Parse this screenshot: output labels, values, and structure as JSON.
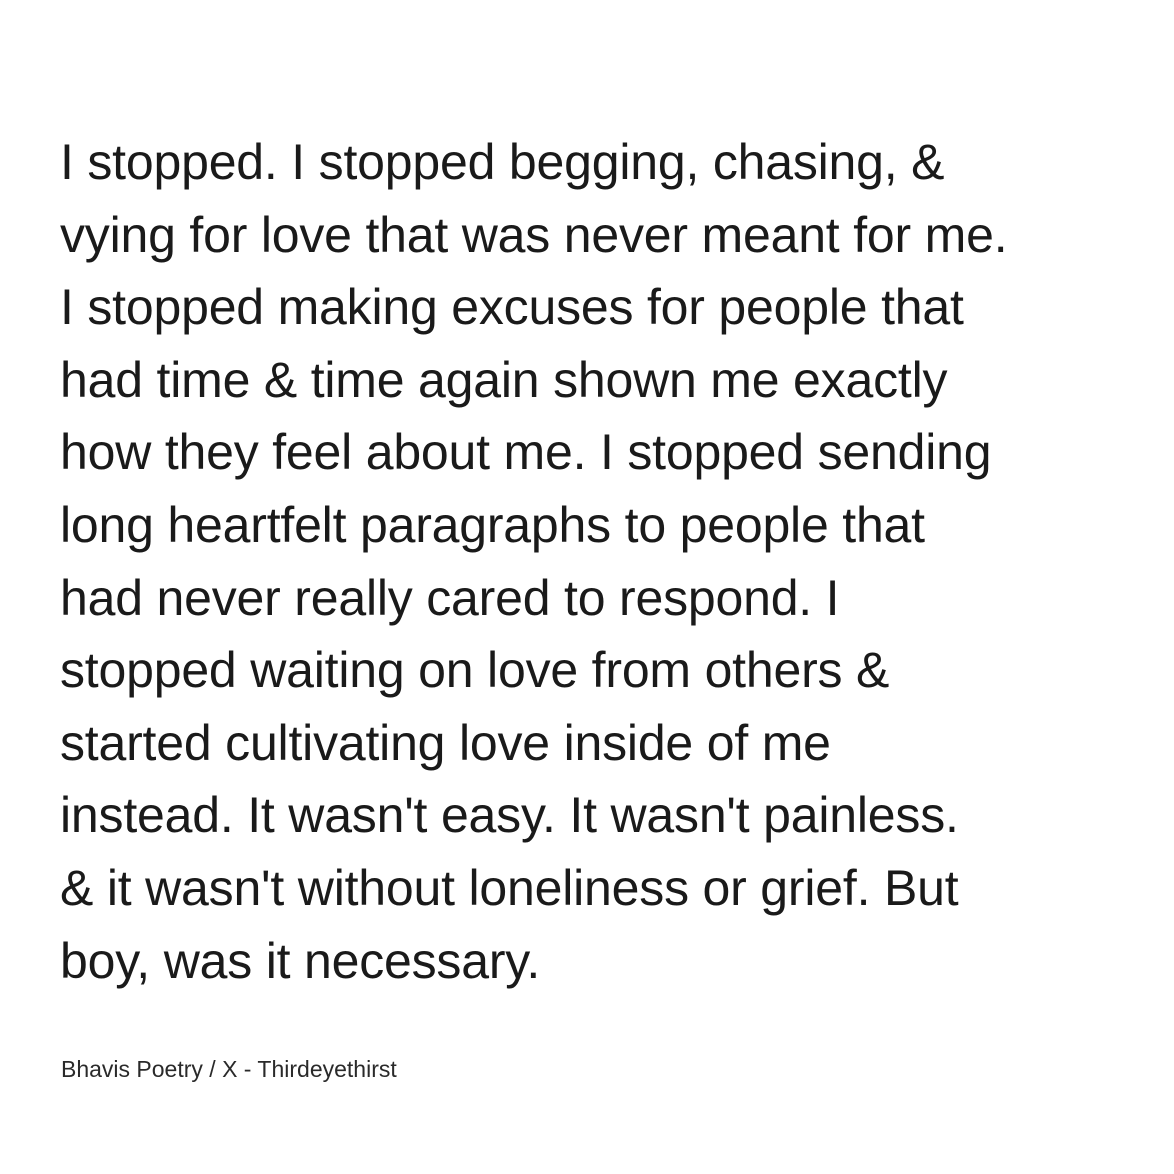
{
  "poem": {
    "lines": [
      "I stopped. I stopped begging, chasing, &",
      "vying for love that was never meant for me.",
      "I stopped making excuses for people that",
      "had time & time again shown me exactly",
      "how they feel about me. I stopped sending",
      "long heartfelt paragraphs to people that",
      "had never really cared to respond. I",
      "stopped waiting on love from others &",
      "started cultivating love inside of me",
      "instead. It wasn't easy. It wasn't painless.",
      "& it wasn't without loneliness or grief. But",
      "boy, was it necessary."
    ]
  },
  "credit": "Bhavis Poetry / X - Thirdeyethirst",
  "colors": {
    "background": "#ffffff",
    "text": "#1a1a1a"
  }
}
